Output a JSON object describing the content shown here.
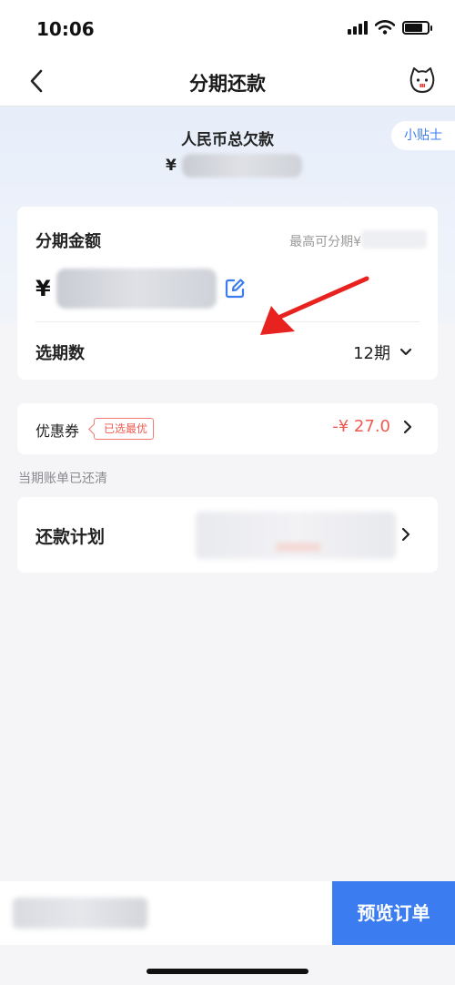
{
  "status_bar": {
    "time": "10:06"
  },
  "nav": {
    "title": "分期还款",
    "back_icon": "chevron-left-icon",
    "mascot_icon": "cat-mascot-icon"
  },
  "hero": {
    "label": "人民币总欠款",
    "currency": "¥",
    "tips_label": "小贴士"
  },
  "installment_card": {
    "title": "分期金额",
    "max_label": "最高可分期¥",
    "currency": "¥",
    "edit_icon": "edit-icon",
    "period_label": "选期数",
    "period_value": "12期"
  },
  "coupon_card": {
    "label": "优惠券",
    "badge": "已选最优",
    "value": "-¥ 27.0"
  },
  "bill_note": "当期账单已还清",
  "plan_card": {
    "label": "还款计划"
  },
  "bottom_bar": {
    "preview_label": "预览订单"
  },
  "colors": {
    "accent": "#3b7df0",
    "discount": "#ef5a50",
    "annotation": "#e8231f"
  }
}
